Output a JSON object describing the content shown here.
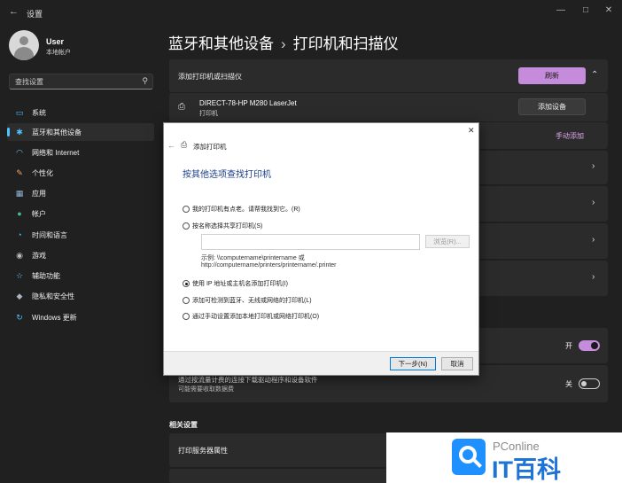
{
  "window": {
    "title": "设置",
    "controls": [
      "minimize-icon",
      "maximize-icon",
      "close-icon"
    ]
  },
  "user": {
    "name": "User",
    "account_type": "本地帐户"
  },
  "search": {
    "placeholder": "查找设置"
  },
  "sidebar": {
    "items": [
      {
        "label": "系统",
        "icon": "system-icon",
        "color": "#4cc2ff"
      },
      {
        "label": "蓝牙和其他设备",
        "icon": "bluetooth-icon",
        "color": "#4cc2ff",
        "active": true
      },
      {
        "label": "网络和 Internet",
        "icon": "wifi-icon",
        "color": "#6cc6ff"
      },
      {
        "label": "个性化",
        "icon": "brush-icon",
        "color": "#f0a860"
      },
      {
        "label": "应用",
        "icon": "apps-icon",
        "color": "#8fb5d9"
      },
      {
        "label": "帐户",
        "icon": "account-icon",
        "color": "#3fbf8f"
      },
      {
        "label": "时间和语言",
        "icon": "globe-clock-icon",
        "color": "#4cc2ff"
      },
      {
        "label": "游戏",
        "icon": "gamepad-icon",
        "color": "#bbbbbb"
      },
      {
        "label": "辅助功能",
        "icon": "accessibility-icon",
        "color": "#6cc6ff"
      },
      {
        "label": "隐私和安全性",
        "icon": "shield-icon",
        "color": "#aab4c0"
      },
      {
        "label": "Windows 更新",
        "icon": "update-icon",
        "color": "#4cc2ff"
      }
    ]
  },
  "breadcrumb": {
    "parent": "蓝牙和其他设备",
    "separator": "›",
    "current": "打印机和扫描仪"
  },
  "main": {
    "add_section_label": "添加打印机或扫描仪",
    "refresh_label": "刷新",
    "device": {
      "name": "DIRECT-78-HP M280 LaserJet",
      "type": "打印机"
    },
    "add_device_label": "添加设备",
    "manual_add_label": "手动添加",
    "toggle_on_label": "开",
    "metered_title": "通过按流量计费的连接下载驱动程序和设备软件",
    "metered_sub": "可能需要收取数据费",
    "toggle_off_label": "关",
    "related_header": "相关设置",
    "print_server_label": "打印服务器属性"
  },
  "dialog": {
    "title": "添加打印机",
    "heading": "按其他选项查找打印机",
    "options": [
      {
        "label": "我的打印机有点老。请帮我找到它。(R)",
        "checked": false
      },
      {
        "label": "按名称选择共享打印机(S)",
        "checked": false
      },
      {
        "label": "使用 IP 地址或主机名添加打印机(I)",
        "checked": true
      },
      {
        "label": "添加可检测到蓝牙、无线或网络的打印机(L)",
        "checked": false
      },
      {
        "label": "通过手动设置添加本地打印机或网络打印机(O)",
        "checked": false
      }
    ],
    "browse_label": "浏览(R)...",
    "example_line1": "示例: \\\\computername\\printername 或",
    "example_line2": "http://computername/printers/printername/.printer",
    "next_label": "下一步(N)",
    "cancel_label": "取消"
  },
  "watermark": {
    "brand": "PConline",
    "text": "IT百科"
  }
}
